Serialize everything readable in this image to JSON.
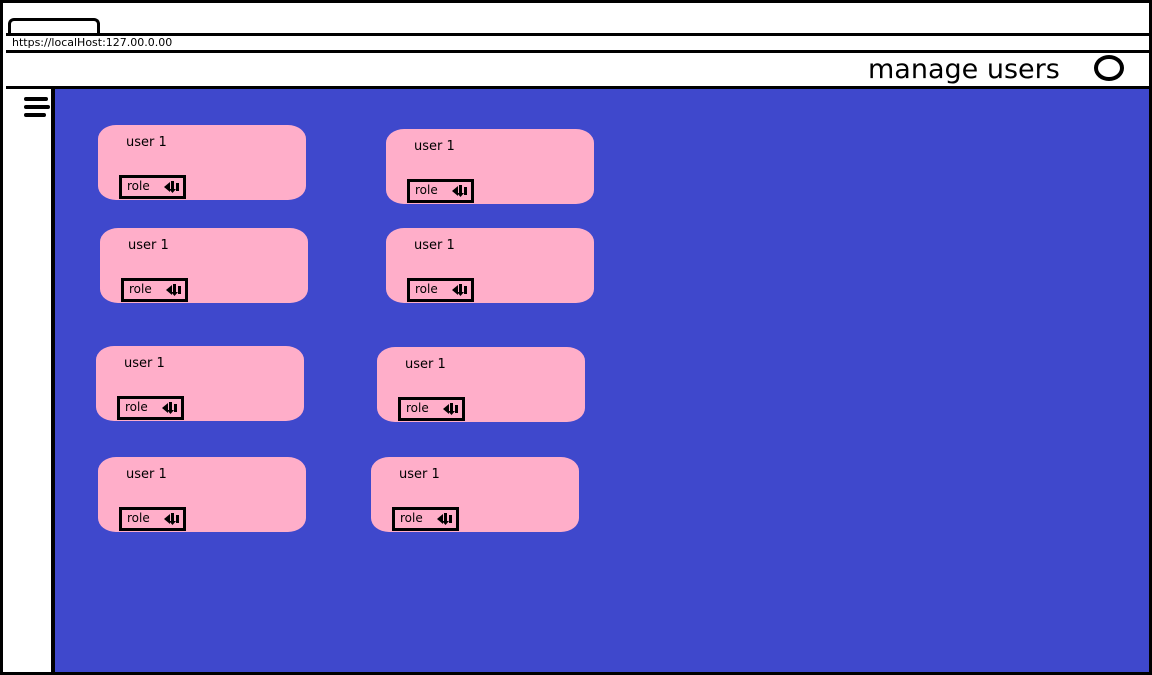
{
  "browser": {
    "url": "https://localHost:127.00.0.00"
  },
  "header": {
    "title": "manage users"
  },
  "icons": {
    "menu": "hamburger-menu-icon",
    "profile": "profile-circle-icon",
    "dropdown": "chevron-down-icon"
  },
  "colors": {
    "main_background": "#3f48cc",
    "card_background": "#ffaec9"
  },
  "users": [
    {
      "name": "user 1",
      "role_label": "role"
    },
    {
      "name": "user 1",
      "role_label": "role"
    },
    {
      "name": "user 1",
      "role_label": "role"
    },
    {
      "name": "user 1",
      "role_label": "role"
    },
    {
      "name": "user 1",
      "role_label": "role"
    },
    {
      "name": "user 1",
      "role_label": "role"
    },
    {
      "name": "user 1",
      "role_label": "role"
    },
    {
      "name": "user 1",
      "role_label": "role"
    }
  ]
}
